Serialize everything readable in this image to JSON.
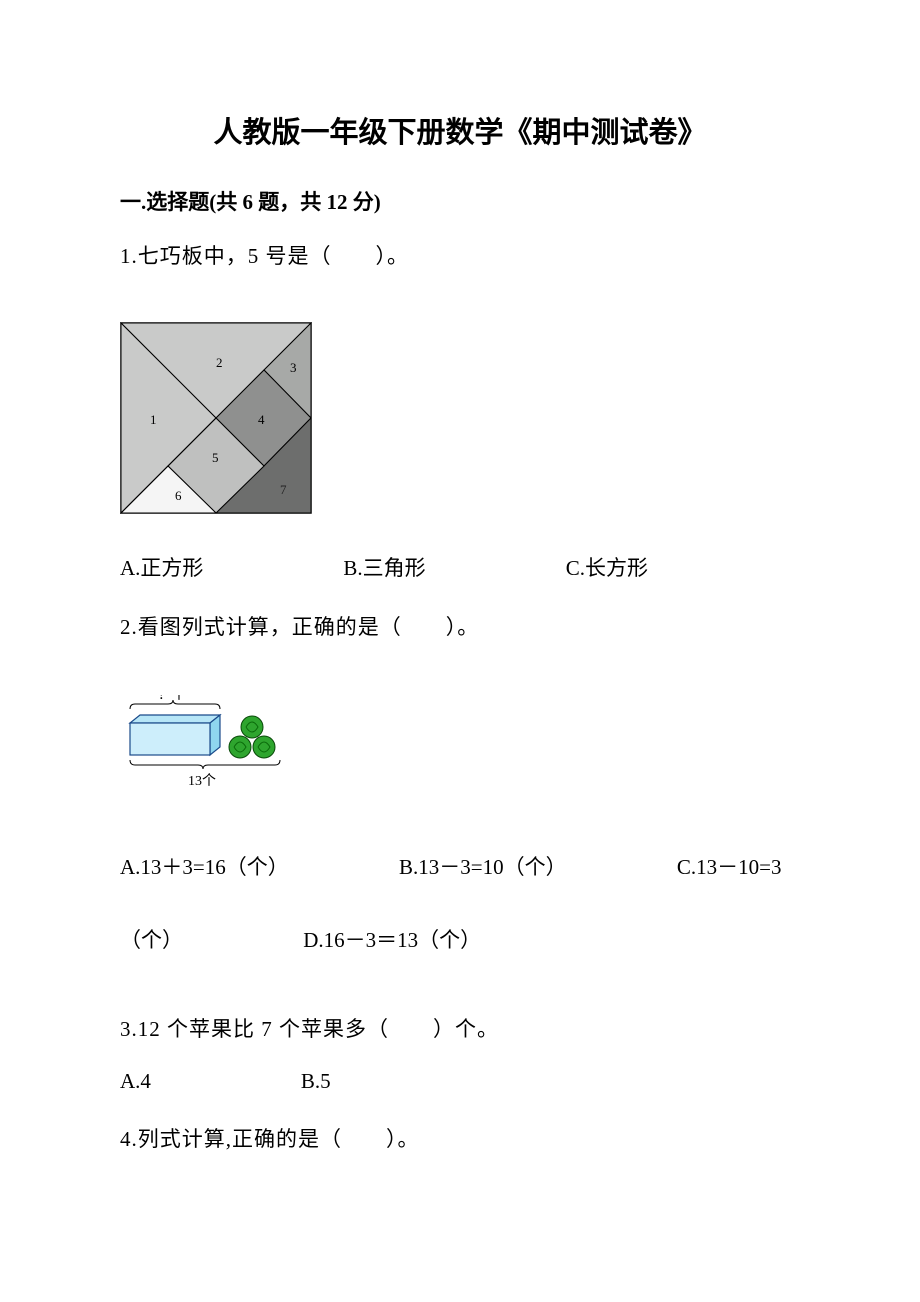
{
  "title": "人教版一年级下册数学《期中测试卷》",
  "section": {
    "label": "一.选择题(共 6 题，共 12 分)"
  },
  "q1": {
    "text": "1.七巧板中，5 号是（　　）。",
    "tangram_labels": [
      "1",
      "2",
      "3",
      "4",
      "5",
      "6",
      "7"
    ],
    "optA": "A.正方形",
    "optB": "B.三角形",
    "optC": "C.长方形"
  },
  "q2": {
    "text": "2.看图列式计算，正确的是（　　）。",
    "fig_top": "？个",
    "fig_bottom": "13个",
    "optA": "A.13＋3=16（个）",
    "optB": "B.13－3=10（个）",
    "optC": "C.13－10=3",
    "optC2": "（个）",
    "optD": "D.16－3＝13（个）"
  },
  "q3": {
    "text": "3.12 个苹果比 7 个苹果多（　　）个。",
    "optA": "A.4",
    "optB": "B.5"
  },
  "q4": {
    "text": "4.列式计算,正确的是（　　）。"
  }
}
